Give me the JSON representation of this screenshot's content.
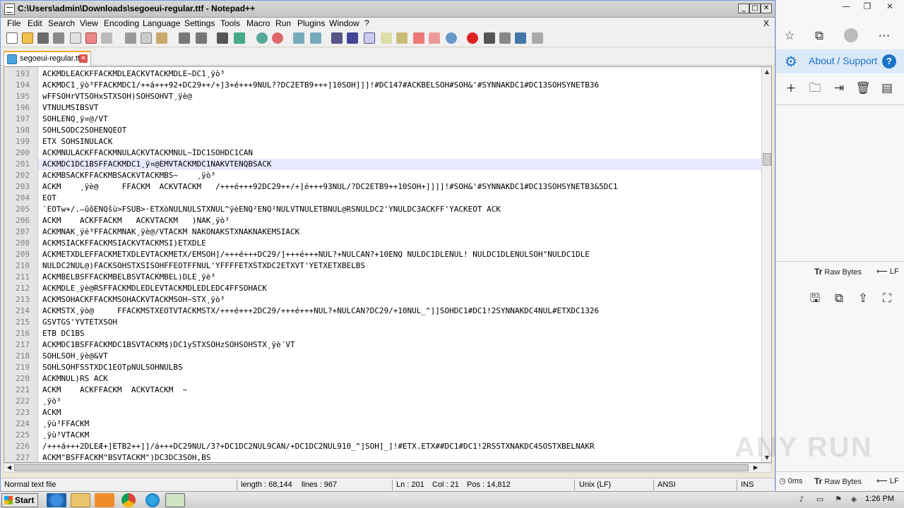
{
  "window": {
    "title": "C:\\Users\\admin\\Downloads\\segoeui-regular.ttf - Notepad++",
    "buttons": {
      "minimize": "_",
      "maximize": "□",
      "close": "✕"
    }
  },
  "menu": {
    "items": [
      "File",
      "Edit",
      "Search",
      "View",
      "Encoding",
      "Language",
      "Settings",
      "Tools",
      "Macro",
      "Run",
      "Plugins",
      "Window",
      "?"
    ],
    "close": "X"
  },
  "tab": {
    "label": "segoeui-regular.ttf",
    "close": "✕"
  },
  "editor": {
    "current_line": 201,
    "lines": [
      {
        "n": "193",
        "t": "ACKMDLEACKFFACKMDLEACKVTACKMDLE~DC1¸ÿò³"
      },
      {
        "n": "194",
        "t": "ACKMDC1¸ÿò³FFACKMDC1/++á+++92+DC29++/+]3+é+++9NUL??DC2ETB9+++]10SOH]]]!#DC147#ACKBELSOH#SOH&'#SYNNAKDC1#DC13SOHSYNETB36"
      },
      {
        "n": "195",
        "t": "wFFSOHrVTSOHxSTXSOH)SOHSOHVT¸ÿè@"
      },
      {
        "n": "196",
        "t": "VTNULMSIBSVT"
      },
      {
        "n": "197",
        "t": "SOHLENQ¸ÿ¤@/VT"
      },
      {
        "n": "198",
        "t": "SOHLSODC2SOHENQEOT"
      },
      {
        "n": "199",
        "t": "ETX SOHSINULACK"
      },
      {
        "n": "200",
        "t": "ACKMNULACKFFACKMNULACKVTACKMNUL~ÌDC1SOHDC1CAN"
      },
      {
        "n": "201",
        "t": "ACKMDC1DC1BSFFACKMDC1¸ÿ¤@EMVTACKMDC1NAKVTENQBSACK"
      },
      {
        "n": "202",
        "t": "ACKMBSACKFFACKMBSACKVTACKMBS~    ¸ÿò³"
      },
      {
        "n": "203",
        "t": "ACKM    ¸ÿè@     FFACKM  ACKVTACKM   /+++é+++92DC29++/+]é+++93NUL/?DC2ETB9++10SOH+]]]]!#SOH&'#SYNNAKDC1#DC13SOHSYNETB3&5DC1"
      },
      {
        "n": "204",
        "t": "EOT"
      },
      {
        "n": "205",
        "t": "`EOTw+/.—ûôENQšù>FSUB>·ETXòNULNULSTXNUL^ÿèENQ²ENQ²NULVTNULETBNUL@RSNULDC2'YNULDC3ACKFF'YACKEOT ACK"
      },
      {
        "n": "206",
        "t": "ACKM    ACKFFACKM   ACKVTACKM   )NAK¸ÿò³"
      },
      {
        "n": "207",
        "t": "ACKMNAK¸ÿé³FFACKMNAK¸ÿè@/VTACKM NAKONAKSTXNAKNAKEMSIACK"
      },
      {
        "n": "208",
        "t": "ACKMSIACKFFACKMSIACKVTACKMSI)ETXDLE"
      },
      {
        "n": "209",
        "t": "ACKMETXDLEFFACKMETXDLEVTACKMETX/EMSOH]/+++é+++DC29/]+++é+++NUL?+NULCAN?+10ENQ NULDC1DLENUL! NULDC1DLENULSOH\"NULDC1DLE"
      },
      {
        "n": "210",
        "t": "NULDC2NUL@)FACKSOHSTXSISOHFFEOTFFNUL'YFFFFETXSTXDC2ETXVT'YETXETXBELBS"
      },
      {
        "n": "211",
        "t": "ACKMBELBSFFACKMBELBSVTACKMBEL)DLE¸ÿè³"
      },
      {
        "n": "212",
        "t": "ACKMDLE¸ÿè@RSFFACKMDLEDLEVTACKMDLEDLEDC4FFSOHACK"
      },
      {
        "n": "213",
        "t": "ACKMSOHACKFFACKMSOHACKVTACKMSOH~STX¸ÿò³"
      },
      {
        "n": "214",
        "t": "ACKMSTX¸ÿò@     FFACKMSTXEOTVTACKMSTX/+++é+++2DC29/+++é+++NUL?+NULCAN?DC29/+10NUL_^]]SOHDC1#DC1!2SYNNAKDC4NUL#ETXDC1326"
      },
      {
        "n": "215",
        "t": "GSVTGS'YVTETXSOH"
      },
      {
        "n": "216",
        "t": "ETB DC1BS"
      },
      {
        "n": "217",
        "t": "ACKMDC1BSFFACKMDC1BSVTACKM$)DC1ySTXSOHzSOHSOHSTX¸ÿè´VT"
      },
      {
        "n": "218",
        "t": "SOHLSOH¸ÿè@&VT"
      },
      {
        "n": "219",
        "t": "SOHLSOHFSSTXDC1EOTpNULSOHNULBS"
      },
      {
        "n": "220",
        "t": "ACKMNUL)RS ACK"
      },
      {
        "n": "221",
        "t": "ACKM    ACKFFACKM  ACKVTACKM  ~"
      },
      {
        "n": "222",
        "t": "¸ÿò³"
      },
      {
        "n": "223",
        "t": "ACKM"
      },
      {
        "n": "224",
        "t": "¸ÿù³FFACKM"
      },
      {
        "n": "225",
        "t": "¸ÿù³VTACKM"
      },
      {
        "n": "226",
        "t": "/+++á+++2DLEÆ+]ETB2++]]/á+++DC29NUL/3?+DC1DC2NUL9CAN/+DC1DC2NUL910_^]SOH]_]!#ETX.ETX##DC1#DC1!2RSSTXNAKDC4SOSTXBELNAKR"
      },
      {
        "n": "227",
        "t": "ACKM\"BSFFACKM\"BSVTACKM\")DC3DC3SOH,BS"
      }
    ]
  },
  "status": {
    "file_type": "Normal text file",
    "length": "length : 68,144",
    "lines": "lines : 967",
    "ln": "Ln : 201",
    "col": "Col : 21",
    "pos": "Pos : 14,812",
    "eol": "Unix (LF)",
    "encoding": "ANSI",
    "mode": "INS"
  },
  "browser": {
    "about_label": "About / Support",
    "raw_bytes_label": "Raw Bytes",
    "lf_label": "LF",
    "ms_label": "0ms",
    "raw_bytes_label2": "Raw Bytes",
    "lf_label2": "LF",
    "accent": "#1a73c8"
  },
  "taskbar": {
    "start_label": "Start",
    "clock": "1:26 PM"
  },
  "watermark": "ANY RUN"
}
